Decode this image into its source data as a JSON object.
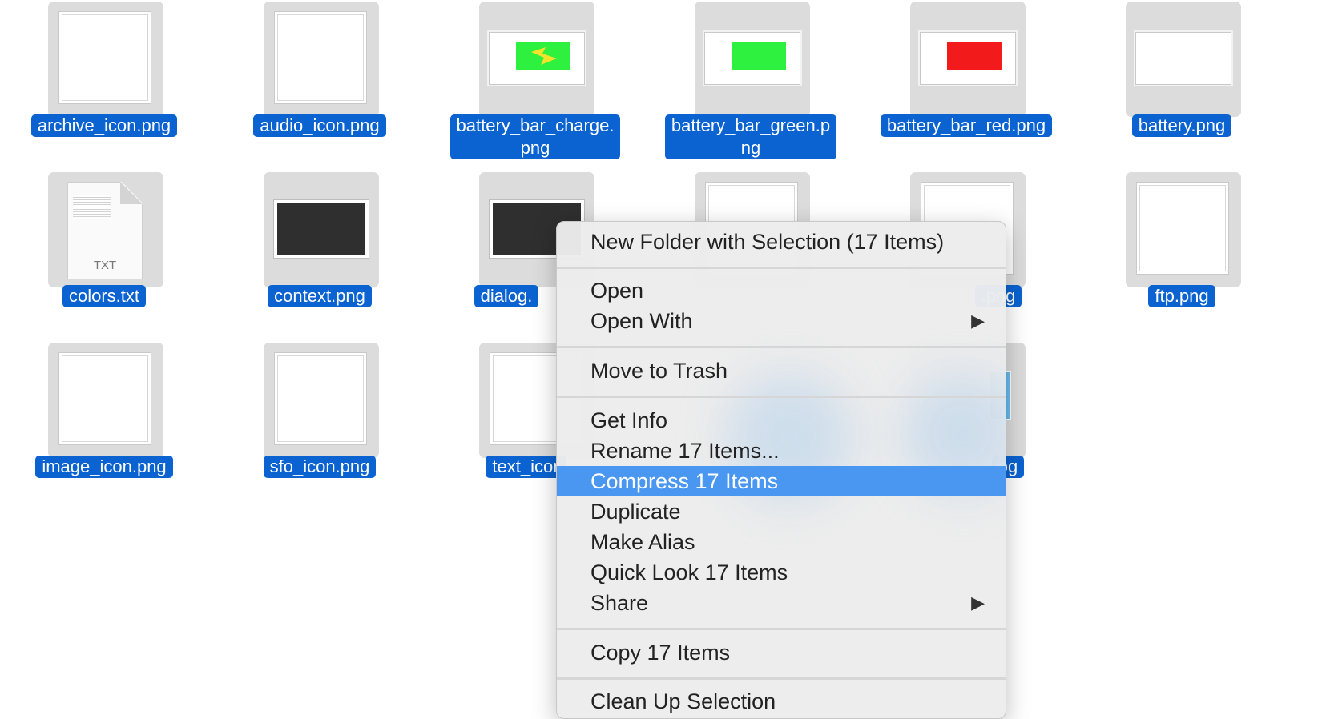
{
  "files": [
    {
      "name": "archive_icon.png"
    },
    {
      "name": "audio_icon.png"
    },
    {
      "name": "battery_bar_charge.\npng"
    },
    {
      "name": "battery_bar_green.p\nng"
    },
    {
      "name": "battery_bar_red.png"
    },
    {
      "name": "battery.png"
    },
    {
      "name": "colors.txt",
      "ext": "TXT"
    },
    {
      "name": "context.png"
    },
    {
      "name": "dialog."
    },
    {
      "name": ".png"
    },
    {
      "name": "ftp.png"
    },
    {
      "name": "image_icon.png"
    },
    {
      "name": "sfo_icon.png"
    },
    {
      "name": "text_icor"
    },
    {
      "name": "og"
    }
  ],
  "colors": {
    "selection_label": "#0a63d1",
    "menu_highlight": "#4a97f2",
    "battery_green": "#2ef03f",
    "battery_red": "#f21a1a",
    "battery_bolt": "#f2e22a"
  },
  "context_menu": {
    "new_folder": "New Folder with Selection (17 Items)",
    "open": "Open",
    "open_with": "Open With",
    "move_to_trash": "Move to Trash",
    "get_info": "Get Info",
    "rename": "Rename 17 Items...",
    "compress": "Compress 17 Items",
    "duplicate": "Duplicate",
    "make_alias": "Make Alias",
    "quick_look": "Quick Look 17 Items",
    "share": "Share",
    "copy": "Copy 17 Items",
    "clean_up": "Clean Up Selection",
    "submenu_arrow": "▶"
  }
}
